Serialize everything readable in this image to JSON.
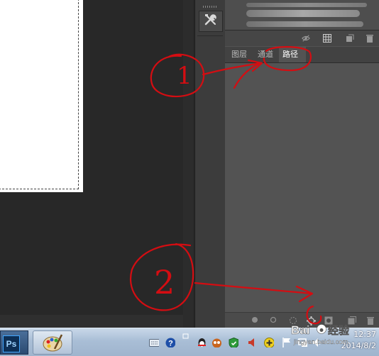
{
  "panel": {
    "tabs": [
      {
        "label": "图层",
        "active": false
      },
      {
        "label": "通道",
        "active": false
      },
      {
        "label": "路径",
        "active": true
      }
    ]
  },
  "annotations": {
    "circle_1_label": "1",
    "circle_2_label": "2"
  },
  "taskbar": {
    "ps_label": "Ps",
    "clock_time": "12:37",
    "clock_date": "2014/8/2"
  },
  "watermark": {
    "brand": "Bai",
    "brand_suffix": "经验",
    "url": "jingyan.baidu.com"
  },
  "colors": {
    "annotation_red": "#d40d12",
    "panel_bg": "#535353",
    "canvas_bg": "#282828"
  },
  "icons": [
    "tools-icon",
    "eye-icon",
    "grid-icon",
    "new-layer-icon",
    "trash-icon",
    "fill-path-icon",
    "stroke-path-icon",
    "load-selection-icon",
    "make-work-path-icon",
    "add-mask-icon",
    "create-new-path-icon",
    "delete-path-icon",
    "keyboard-icon",
    "help-icon",
    "speaker-icon",
    "qq-icon",
    "security-shield-icon",
    "network-icon"
  ]
}
